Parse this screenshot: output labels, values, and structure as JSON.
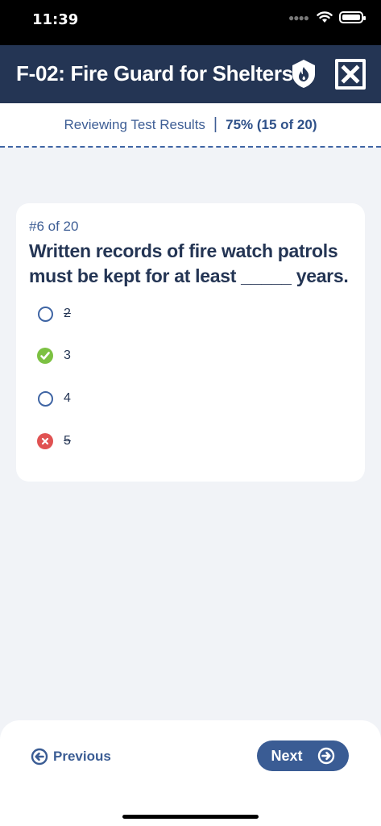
{
  "status_bar": {
    "time": "11:39"
  },
  "header": {
    "title": "F-02: Fire Guard for Shelters",
    "shield_icon": "shield-flame-icon",
    "close_icon": "close-icon"
  },
  "results": {
    "label": "Reviewing Test Results",
    "separator": "|",
    "score": "75% (15 of 20)"
  },
  "question": {
    "number": "#6 of 20",
    "text": "Written records of fire watch patrols must be kept for at least _____ years.",
    "options": [
      {
        "label": "2",
        "state": "unselected",
        "struck": true
      },
      {
        "label": "3",
        "state": "correct",
        "struck": false
      },
      {
        "label": "4",
        "state": "unselected",
        "struck": false
      },
      {
        "label": "5",
        "state": "incorrect",
        "struck": true
      }
    ]
  },
  "navigation": {
    "previous_label": "Previous",
    "next_label": "Next"
  },
  "colors": {
    "navy": "#243554",
    "blue": "#3a5c94",
    "correct": "#7cc142",
    "incorrect": "#e05252"
  }
}
